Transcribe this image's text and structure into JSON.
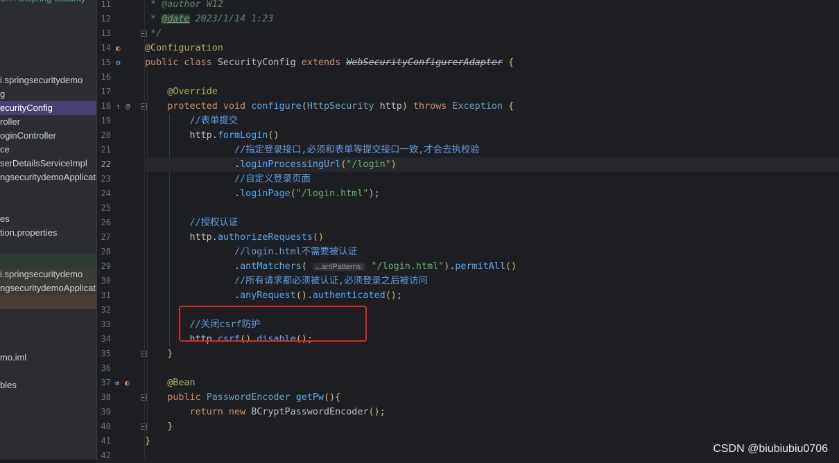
{
  "sidebar": {
    "top_partial": "C:\\Y\\s\\spring-security",
    "items": [
      {
        "label": "i.springsecuritydemo",
        "type": "normal"
      },
      {
        "label": "g",
        "type": "normal"
      },
      {
        "label": "ecurityConfig",
        "type": "selected"
      },
      {
        "label": "roller",
        "type": "normal"
      },
      {
        "label": "oginController",
        "type": "normal"
      },
      {
        "label": "ce",
        "type": "normal"
      },
      {
        "label": "serDetailsServiceImpl",
        "type": "normal"
      },
      {
        "label": "ngsecuritydemoApplicatio",
        "type": "normal"
      },
      {
        "label": "",
        "type": "normal"
      },
      {
        "label": "",
        "type": "normal"
      },
      {
        "label": "es",
        "type": "normal"
      },
      {
        "label": "tion.properties",
        "type": "normal"
      },
      {
        "label": "",
        "type": "normal"
      },
      {
        "label": "",
        "type": "band-top"
      },
      {
        "label": "i.springsecuritydemo",
        "type": "band"
      },
      {
        "label": "ngsecuritydemoApplicatio",
        "type": "band"
      },
      {
        "label": "",
        "type": "band-bottom"
      },
      {
        "label": "",
        "type": "normal"
      },
      {
        "label": "",
        "type": "normal"
      },
      {
        "label": "",
        "type": "normal"
      },
      {
        "label": "mo.iml",
        "type": "normal"
      },
      {
        "label": "",
        "type": "normal"
      },
      {
        "label": "bles",
        "type": "normal"
      }
    ]
  },
  "code": {
    "current_line": 22,
    "lines": [
      {
        "n": 11,
        "t": [
          [
            "c-doc",
            " * @author"
          ],
          [
            "c-doc",
            " W12"
          ]
        ]
      },
      {
        "n": 12,
        "t": [
          [
            "c-doc",
            " * "
          ],
          [
            "c-doctag",
            "@date"
          ],
          [
            "c-doc",
            " 2023/1/14 1:23"
          ]
        ]
      },
      {
        "n": 13,
        "t": [
          [
            "c-doc",
            " */"
          ]
        ]
      },
      {
        "n": 14,
        "t": [
          [
            "c-ann",
            "@Configuration"
          ]
        ]
      },
      {
        "n": 15,
        "t": [
          [
            "c-kw",
            "public class "
          ],
          [
            "c-cls",
            "SecurityConfig "
          ],
          [
            "c-kw",
            "extends "
          ],
          [
            "c-strike",
            "WebSecurityConfigurerAdapter"
          ],
          [
            "c-cls",
            " "
          ],
          [
            "c-brk",
            "{"
          ]
        ]
      },
      {
        "n": 16,
        "t": []
      },
      {
        "n": 17,
        "t": [
          [
            "c-cls",
            "    "
          ],
          [
            "c-ann",
            "@Override"
          ]
        ]
      },
      {
        "n": 18,
        "t": [
          [
            "c-cls",
            "    "
          ],
          [
            "c-kw",
            "protected void "
          ],
          [
            "c-meth",
            "configure"
          ],
          [
            "c-brk",
            "("
          ],
          [
            "c-type",
            "HttpSecurity "
          ],
          [
            "c-param",
            "http"
          ],
          [
            "c-brk",
            ")"
          ],
          [
            "c-kw",
            " throws "
          ],
          [
            "c-type",
            "Exception "
          ],
          [
            "c-brk",
            "{"
          ]
        ]
      },
      {
        "n": 19,
        "t": [
          [
            "c-cls",
            "        "
          ],
          [
            "c-cncom",
            "//表单提交"
          ]
        ]
      },
      {
        "n": 20,
        "t": [
          [
            "c-cls",
            "        "
          ],
          [
            "c-param",
            "http"
          ],
          [
            "c-cls",
            "."
          ],
          [
            "c-meth",
            "formLogin"
          ],
          [
            "c-brk",
            "()"
          ]
        ]
      },
      {
        "n": 21,
        "t": [
          [
            "c-cls",
            "                "
          ],
          [
            "c-cncom",
            "//指定登录接口,必须和表单等提交接口一致,才会去执校验"
          ]
        ]
      },
      {
        "n": 22,
        "t": [
          [
            "c-cls",
            "                ."
          ],
          [
            "c-meth",
            "loginProcessingUrl"
          ],
          [
            "c-brk",
            "("
          ],
          [
            "c-str",
            "\"/login\""
          ],
          [
            "c-brk",
            ")"
          ]
        ]
      },
      {
        "n": 23,
        "t": [
          [
            "c-cls",
            "                "
          ],
          [
            "c-cncom",
            "//自定义登录页面"
          ]
        ]
      },
      {
        "n": 24,
        "t": [
          [
            "c-cls",
            "                ."
          ],
          [
            "c-meth",
            "loginPage"
          ],
          [
            "c-brk",
            "("
          ],
          [
            "c-str",
            "\"/login.html\""
          ],
          [
            "c-brk",
            ")"
          ],
          [
            "c-cls",
            ";"
          ]
        ]
      },
      {
        "n": 25,
        "t": []
      },
      {
        "n": 26,
        "t": [
          [
            "c-cls",
            "        "
          ],
          [
            "c-cncom",
            "//授权认证"
          ]
        ]
      },
      {
        "n": 27,
        "t": [
          [
            "c-cls",
            "        "
          ],
          [
            "c-param",
            "http"
          ],
          [
            "c-cls",
            "."
          ],
          [
            "c-meth",
            "authorizeRequests"
          ],
          [
            "c-brk",
            "()"
          ]
        ]
      },
      {
        "n": 28,
        "t": [
          [
            "c-cls",
            "                "
          ],
          [
            "c-cncom",
            "//login.html不需要被认证"
          ]
        ]
      },
      {
        "n": 29,
        "t": [
          [
            "c-cls",
            "                ."
          ],
          [
            "c-meth",
            "antMatchers"
          ],
          [
            "c-brk",
            "("
          ],
          [
            "c-cls",
            " "
          ],
          [
            "c-hint",
            "...antPatterns:"
          ],
          [
            "c-cls",
            " "
          ],
          [
            "c-str",
            "\"/login.html\""
          ],
          [
            "c-brk",
            ")"
          ],
          [
            "c-cls",
            "."
          ],
          [
            "c-meth",
            "permitAll"
          ],
          [
            "c-brk",
            "()"
          ]
        ]
      },
      {
        "n": 30,
        "t": [
          [
            "c-cls",
            "                "
          ],
          [
            "c-cncom",
            "//所有请求都必须被认证,必须登录之后被访问"
          ]
        ]
      },
      {
        "n": 31,
        "t": [
          [
            "c-cls",
            "                ."
          ],
          [
            "c-meth",
            "anyRequest"
          ],
          [
            "c-brk",
            "()"
          ],
          [
            "c-cls",
            "."
          ],
          [
            "c-meth",
            "authenticated"
          ],
          [
            "c-brk",
            "()"
          ],
          [
            "c-cls",
            ";"
          ]
        ]
      },
      {
        "n": 32,
        "t": []
      },
      {
        "n": 33,
        "t": [
          [
            "c-cls",
            "        "
          ],
          [
            "c-cncom",
            "//关闭csrf防护"
          ]
        ]
      },
      {
        "n": 34,
        "t": [
          [
            "c-cls",
            "        "
          ],
          [
            "c-param",
            "http"
          ],
          [
            "c-cls",
            "."
          ],
          [
            "c-meth",
            "csrf"
          ],
          [
            "c-brk",
            "()"
          ],
          [
            "c-cls",
            "."
          ],
          [
            "c-meth",
            "disable"
          ],
          [
            "c-brk",
            "()"
          ],
          [
            "c-cls",
            ";"
          ]
        ]
      },
      {
        "n": 35,
        "t": [
          [
            "c-cls",
            "    "
          ],
          [
            "c-brk",
            "}"
          ]
        ]
      },
      {
        "n": 36,
        "t": []
      },
      {
        "n": 37,
        "t": [
          [
            "c-cls",
            "    "
          ],
          [
            "c-ann",
            "@Bean"
          ]
        ]
      },
      {
        "n": 38,
        "t": [
          [
            "c-cls",
            "    "
          ],
          [
            "c-kw",
            "public "
          ],
          [
            "c-type",
            "PasswordEncoder "
          ],
          [
            "c-meth",
            "getPw"
          ],
          [
            "c-brk",
            "()"
          ],
          [
            "c-brk",
            "{"
          ]
        ]
      },
      {
        "n": 39,
        "t": [
          [
            "c-cls",
            "        "
          ],
          [
            "c-kw",
            "return new "
          ],
          [
            "c-cls",
            "BCryptPasswordEncoder"
          ],
          [
            "c-brk",
            "()"
          ],
          [
            "c-cls",
            ";"
          ]
        ]
      },
      {
        "n": 40,
        "t": [
          [
            "c-cls",
            "    "
          ],
          [
            "c-brk",
            "}"
          ]
        ]
      },
      {
        "n": 41,
        "t": [
          [
            "c-brk",
            "}"
          ]
        ]
      },
      {
        "n": 42,
        "t": []
      }
    ]
  },
  "gutter_icons": [
    {
      "line": 14,
      "icon": "bean-icon",
      "glyph": "◐",
      "color": "#d08a5f"
    },
    {
      "line": 15,
      "icon": "spring-gear-icon",
      "glyph": "⚙",
      "color": "#4fb3d9"
    },
    {
      "line": 18,
      "icon": "override-arrow-icon",
      "glyph": "↑",
      "color": "#c86a8a"
    },
    {
      "line": 18,
      "icon": "at-sign-icon",
      "glyph": "@",
      "color": "#a1a3ab"
    },
    {
      "line": 37,
      "icon": "bean-method-icon",
      "glyph": "⇉",
      "color": "#a1a3ab"
    },
    {
      "line": 37,
      "icon": "bean-icon",
      "glyph": "◐",
      "color": "#d08a5f"
    }
  ],
  "watermark": "CSDN @biubiubiu0706"
}
